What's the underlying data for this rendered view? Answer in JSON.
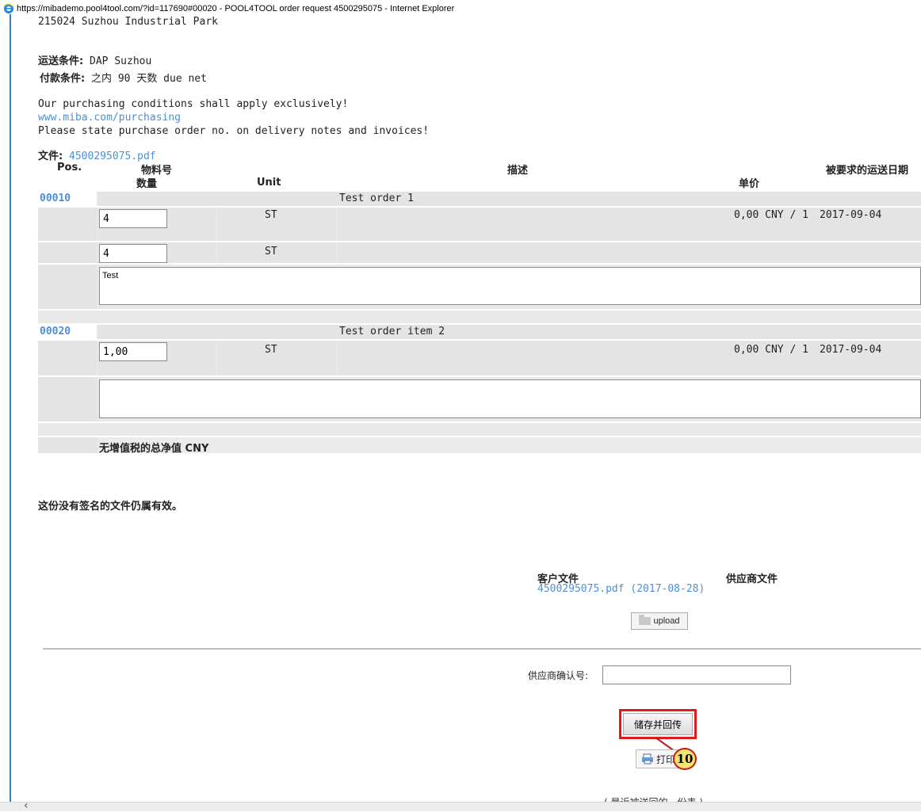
{
  "window": {
    "title": "https://mibademo.pool4tool.com/?id=117690#00020 - POOL4TOOL order request 4500295075 - Internet Explorer"
  },
  "address": {
    "line": "215024 Suzhou Industrial Park"
  },
  "terms": {
    "shipping_label": "运送条件:",
    "shipping_value": " DAP Suzhou",
    "payment_label": "付款条件:",
    "payment_value": " 之内 90 天数 due net"
  },
  "conditions": {
    "line1": "Our purchasing conditions shall apply exclusively!",
    "link": "www.miba.com/purchasing",
    "line2": "Please state purchase order no. on delivery notes and invoices!"
  },
  "file": {
    "label": "文件:",
    "link": "4500295075.pdf"
  },
  "table_headers": {
    "pos": "Pos.",
    "material": "物料号",
    "quantity": "数量",
    "unit": "Unit",
    "description": "描述",
    "unit_price": "单价",
    "requested_date": "被要求的运送日期"
  },
  "items": [
    {
      "pos": "00010",
      "description": "Test order 1",
      "qty1": "4",
      "unit1": "ST",
      "price": "0,00 CNY / 1",
      "date": "2017-09-04",
      "qty2": "4",
      "unit2": "ST",
      "note": "Test"
    },
    {
      "pos": "00020",
      "description": "Test order item 2",
      "qty1": "1,00",
      "unit1": "ST",
      "price": "0,00 CNY / 1",
      "date": "2017-09-04",
      "note": ""
    }
  ],
  "total": {
    "label": "无增值税的总净值 CNY"
  },
  "unsigned_note": "这份没有签名的文件仍属有效。",
  "documents": {
    "customer_header": "客户文件",
    "supplier_header": "供应商文件",
    "customer_file": "4500295075.pdf (2017-08-28)",
    "upload_label": "upload"
  },
  "supplier_confirmation": {
    "label": "供应商确认号:",
    "value": ""
  },
  "actions": {
    "save_send_label": "储存并回传",
    "print_label": "打印"
  },
  "annotation": {
    "badge": "10"
  },
  "footer": {
    "partial": "( 最近被送回的一份表 )"
  },
  "colors": {
    "link": "#4a90d9",
    "highlight": "#e01b1b",
    "badge_fill": "#f5e66b",
    "row_gray": "#e4e4e4"
  }
}
